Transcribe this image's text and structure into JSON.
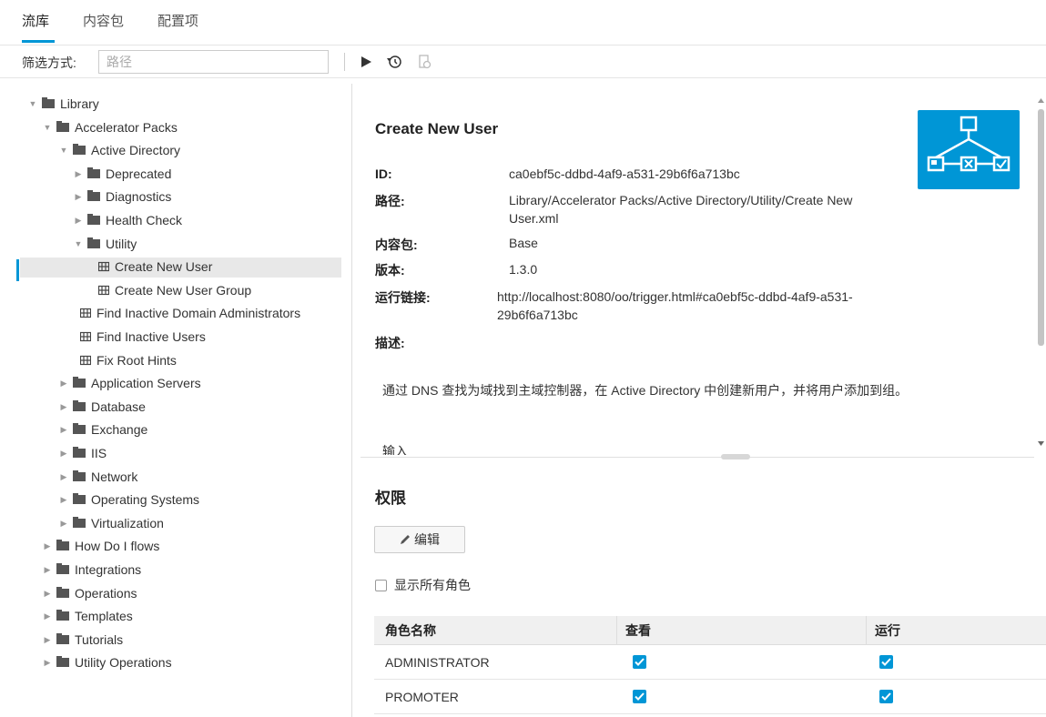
{
  "tabs": [
    {
      "label": "流库",
      "active": true
    },
    {
      "label": "内容包",
      "active": false
    },
    {
      "label": "配置项",
      "active": false
    }
  ],
  "filter": {
    "label": "筛选方式:",
    "placeholder": "路径"
  },
  "toolbar": {
    "icons": [
      "play-icon",
      "run-history-icon",
      "debug-icon"
    ]
  },
  "tree": [
    {
      "label": "Library",
      "type": "folder",
      "level": 0,
      "expanded": true
    },
    {
      "label": "Accelerator Packs",
      "type": "folder",
      "level": 1,
      "expanded": true
    },
    {
      "label": "Active Directory",
      "type": "folder",
      "level": 2,
      "expanded": true
    },
    {
      "label": "Deprecated",
      "type": "folder",
      "level": 3,
      "expanded": false
    },
    {
      "label": "Diagnostics",
      "type": "folder",
      "level": 3,
      "expanded": false
    },
    {
      "label": "Health Check",
      "type": "folder",
      "level": 3,
      "expanded": false
    },
    {
      "label": "Utility",
      "type": "folder",
      "level": 3,
      "expanded": true
    },
    {
      "label": "Create New User",
      "type": "flow",
      "level": 4,
      "selected": true
    },
    {
      "label": "Create New User Group",
      "type": "flow",
      "level": 4
    },
    {
      "label": "Find Inactive Domain Administrators",
      "type": "flow",
      "level": 3
    },
    {
      "label": "Find Inactive Users",
      "type": "flow",
      "level": 3
    },
    {
      "label": "Fix Root Hints",
      "type": "flow",
      "level": 3
    },
    {
      "label": "Application Servers",
      "type": "folder",
      "level": 2,
      "expanded": false
    },
    {
      "label": "Database",
      "type": "folder",
      "level": 2,
      "expanded": false
    },
    {
      "label": "Exchange",
      "type": "folder",
      "level": 2,
      "expanded": false
    },
    {
      "label": "IIS",
      "type": "folder",
      "level": 2,
      "expanded": false
    },
    {
      "label": "Network",
      "type": "folder",
      "level": 2,
      "expanded": false
    },
    {
      "label": "Operating Systems",
      "type": "folder",
      "level": 2,
      "expanded": false
    },
    {
      "label": "Virtualization",
      "type": "folder",
      "level": 2,
      "expanded": false
    },
    {
      "label": "How Do I flows",
      "type": "folder",
      "level": 1,
      "expanded": false
    },
    {
      "label": "Integrations",
      "type": "folder",
      "level": 1,
      "expanded": false
    },
    {
      "label": "Operations",
      "type": "folder",
      "level": 1,
      "expanded": false
    },
    {
      "label": "Templates",
      "type": "folder",
      "level": 1,
      "expanded": false
    },
    {
      "label": "Tutorials",
      "type": "folder",
      "level": 1,
      "expanded": false
    },
    {
      "label": "Utility Operations",
      "type": "folder",
      "level": 1,
      "expanded": false
    }
  ],
  "details": {
    "title": "Create New User",
    "id_label": "ID:",
    "id_value": "ca0ebf5c-ddbd-4af9-a531-29b6f6a713bc",
    "path_label": "路径:",
    "path_value": "Library/Accelerator Packs/Active Directory/Utility/Create New User.xml",
    "pack_label": "内容包:",
    "pack_value": "Base",
    "version_label": "版本:",
    "version_value": "1.3.0",
    "link_label": "运行链接:",
    "link_value": "http://localhost:8080/oo/trigger.html#ca0ebf5c-ddbd-4af9-a531-29b6f6a713bc",
    "desc_label": "描述:",
    "description": "通过 DNS 查找为域找到主域控制器，在 Active Directory 中创建新用户，并将用户添加到组。",
    "cut_text": "输入",
    "flow_icon": "flow-diagram-icon"
  },
  "permissions": {
    "title": "权限",
    "edit_label": "编辑",
    "show_all_label": "显示所有角色",
    "show_all_checked": false,
    "columns": [
      "角色名称",
      "查看",
      "运行"
    ],
    "rows": [
      {
        "role": "ADMINISTRATOR",
        "view": true,
        "run": true
      },
      {
        "role": "PROMOTER",
        "view": true,
        "run": true
      }
    ]
  },
  "colors": {
    "accent": "#0096d6"
  }
}
